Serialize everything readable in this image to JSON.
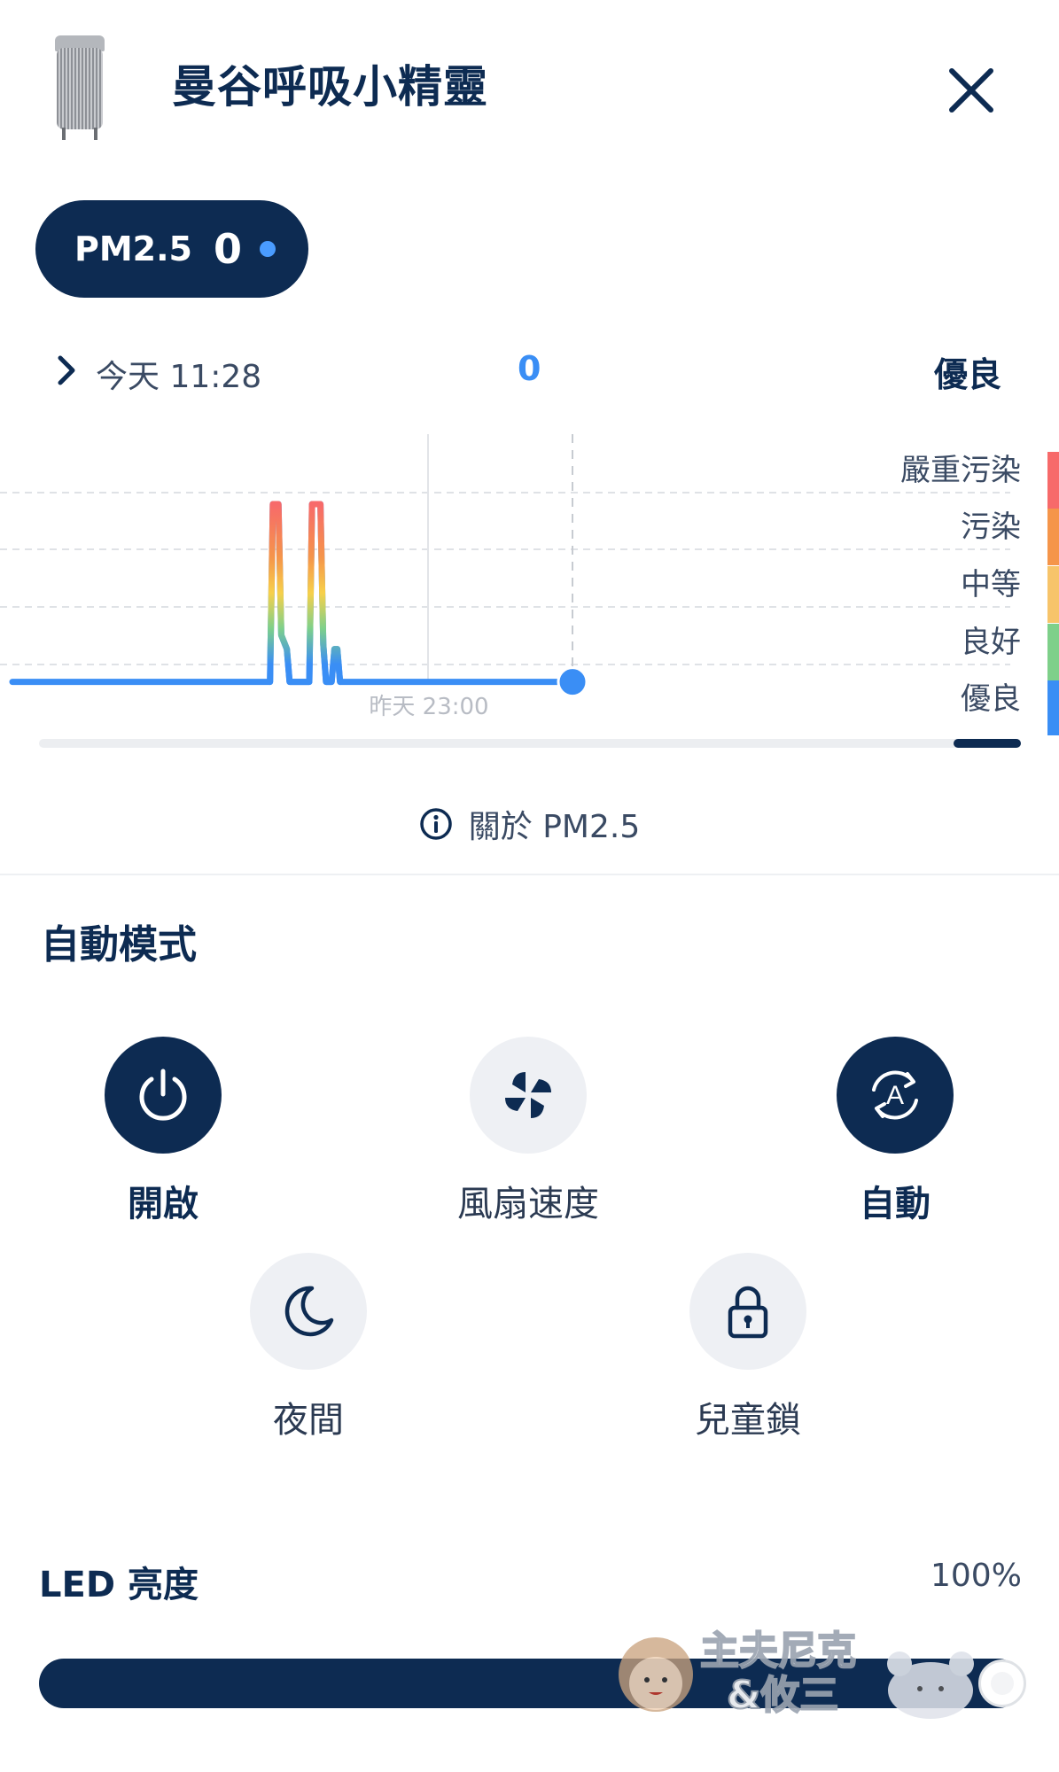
{
  "header": {
    "title": "曼谷呼吸小精靈",
    "device_image": "air-purifier",
    "close_icon": "close-icon"
  },
  "pm_pill": {
    "label": "PM2.5",
    "value": "0",
    "status_color": "#4a9cff"
  },
  "reading_row": {
    "time": "今天 11:28",
    "value": "0",
    "quality": "優良"
  },
  "chart_data": {
    "type": "line",
    "title": "",
    "ylabel": "",
    "xlabel": "",
    "tick_labels_x": [
      "昨天 23:00"
    ],
    "levels": [
      "嚴重污染",
      "污染",
      "中等",
      "良好",
      "優良"
    ],
    "level_colors": [
      "#f76a6a",
      "#f5954a",
      "#f7c46a",
      "#7ed08a",
      "#3a8ef5"
    ],
    "ylim": [
      0,
      5
    ],
    "series": [
      {
        "values": [
          [
            0,
            0.5
          ],
          [
            46,
            0.5
          ],
          [
            46.5,
            4.3
          ],
          [
            47.5,
            4.3
          ],
          [
            48,
            1.5
          ],
          [
            49,
            1.2
          ],
          [
            49.5,
            0.5
          ],
          [
            53,
            0.5
          ],
          [
            53.5,
            4.3
          ],
          [
            55,
            4.3
          ],
          [
            55.5,
            1.3
          ],
          [
            56,
            0.5
          ],
          [
            57,
            0.5
          ],
          [
            57.5,
            1.2
          ],
          [
            58,
            1.2
          ],
          [
            58.5,
            0.5
          ],
          [
            100,
            0.5
          ]
        ]
      }
    ],
    "grid": true,
    "current_x": 100
  },
  "info": {
    "text": "關於 PM2.5"
  },
  "mode": {
    "title": "自動模式",
    "controls": [
      {
        "label": "開啟",
        "icon": "power-icon",
        "active": true
      },
      {
        "label": "風扇速度",
        "icon": "fan-icon",
        "active": false
      },
      {
        "label": "自動",
        "icon": "auto-mode-icon",
        "active": true
      },
      {
        "label": "夜間",
        "icon": "moon-icon",
        "active": false
      },
      {
        "label": "兒童鎖",
        "icon": "lock-icon",
        "active": false
      }
    ]
  },
  "led": {
    "title": "LED 亮度",
    "value": "100%",
    "level": 1.0
  },
  "watermark": {
    "line1": "主夫尼克",
    "line2": "&攸三"
  },
  "colors": {
    "navy": "#0d2b52",
    "accent": "#3a8ef5"
  }
}
